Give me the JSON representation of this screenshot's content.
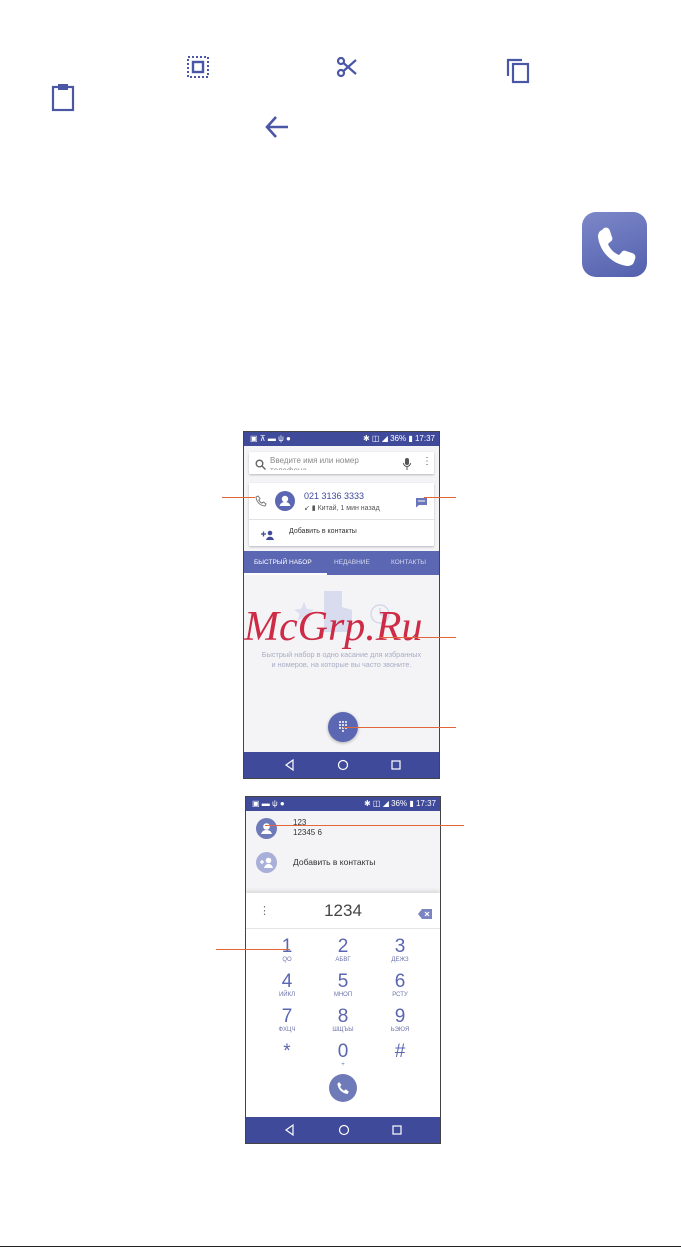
{
  "toolbar_icons": [
    "select-all-icon",
    "cut-icon",
    "copy-icon",
    "paste-icon",
    "back-arrow-icon"
  ],
  "app_icon": "phone-app-icon",
  "watermark": "McGrp.Ru",
  "screen1": {
    "status_time": "17:37",
    "status_battery": "36%",
    "search_placeholder": "Введите имя или номер телефона",
    "recent": {
      "number": "021 3136 3333",
      "detail": "Китай, 1 мин назад",
      "add_contact": "Добавить в контакты"
    },
    "tabs": [
      "БЫСТРЫЙ НАБОР",
      "НЕДАВНИЕ",
      "КОНТАКТЫ"
    ],
    "empty_line1": "Быстрый набор в одно касание для избранных",
    "empty_line2": "и номеров, на которые вы часто звоните."
  },
  "screen2": {
    "status_time": "17:37",
    "status_battery": "36%",
    "suggestion_line1": "123",
    "suggestion_line2": "12345 6",
    "add_contact": "Добавить в контакты",
    "dialed": "1234",
    "keys": [
      {
        "d": "1",
        "l": "QO"
      },
      {
        "d": "2",
        "l": "АБВГ"
      },
      {
        "d": "3",
        "l": "ДЕЖЗ"
      },
      {
        "d": "4",
        "l": "ИЙКЛ"
      },
      {
        "d": "5",
        "l": "МНОП"
      },
      {
        "d": "6",
        "l": "РСТУ"
      },
      {
        "d": "7",
        "l": "ФХЦЧ"
      },
      {
        "d": "8",
        "l": "ШЩЪЫ"
      },
      {
        "d": "9",
        "l": "ЬЭЮЯ"
      },
      {
        "d": "*",
        "l": ""
      },
      {
        "d": "0",
        "l": "+"
      },
      {
        "d": "#",
        "l": ""
      }
    ]
  },
  "colors": {
    "accent": "#3f4a9b",
    "callout": "#e3663a",
    "icon_blue": "#4a56a6",
    "tab_bar": "#5b67b3"
  }
}
